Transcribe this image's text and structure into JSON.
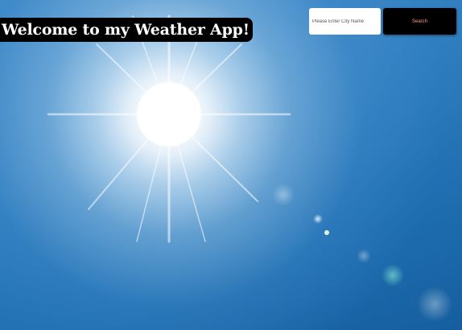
{
  "header": {
    "title": "Welcome to my Weather App!"
  },
  "search": {
    "placeholder": "Please Enter City Name",
    "value": "",
    "button_label": "Search"
  },
  "colors": {
    "title_background": "#000000",
    "title_text": "#ffffff",
    "button_background": "#000000",
    "button_text": "#ff9999",
    "input_background": "#ffffff",
    "sky": "#2b78b8"
  }
}
